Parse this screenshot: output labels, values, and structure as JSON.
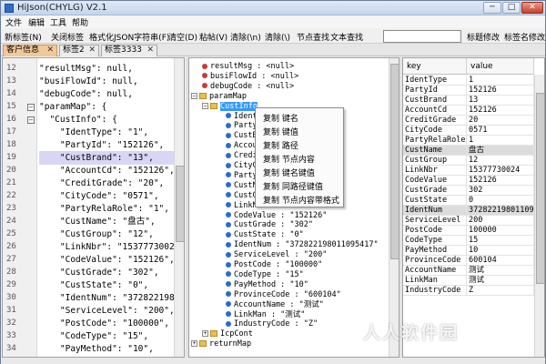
{
  "window": {
    "title": "HiJson(CHYLG) V2.1",
    "min": "─",
    "max": "□",
    "close": "✕"
  },
  "menu": [
    "文件",
    "编辑",
    "工具",
    "帮助"
  ],
  "toolbar": {
    "buttons": [
      "新标签(N)",
      "关闭标签",
      "格式化JSON字符串(F)",
      "清空(D)",
      "粘帖(V)",
      "清除(\\n)",
      "清除(\\)",
      "节点查找",
      "文本查找"
    ],
    "search_value": "",
    "right_buttons": [
      "标题修改",
      "标签名修改"
    ]
  },
  "tabs": [
    {
      "label": "客户信息",
      "close": "✕",
      "active": true
    },
    {
      "label": "标签2",
      "close": "✕",
      "active": false
    },
    {
      "label": "标签3333",
      "close": "✕",
      "active": false
    }
  ],
  "editor": {
    "lines": [
      {
        "n": "12",
        "text": "\"resultMsg\": null,"
      },
      {
        "n": "13",
        "text": "\"busiFlowId\": null,"
      },
      {
        "n": "14",
        "text": "\"debugCode\": null,"
      },
      {
        "n": "15",
        "text": "\"paramMap\": {"
      },
      {
        "n": "16",
        "text": "  \"CustInfo\": {"
      },
      {
        "n": "17",
        "text": "    \"IdentType\": \"1\","
      },
      {
        "n": "18",
        "text": "    \"PartyId\": \"152126\","
      },
      {
        "n": "19",
        "text": "    \"CustBrand\": \"13\","
      },
      {
        "n": "20",
        "text": "    \"AccountCd\": \"152126\","
      },
      {
        "n": "21",
        "text": "    \"CreditGrade\": \"20\","
      },
      {
        "n": "22",
        "text": "    \"CityCode\": \"0571\","
      },
      {
        "n": "23",
        "text": "    \"PartyRelaRole\": \"1\","
      },
      {
        "n": "24",
        "text": "    \"CustName\": \"盘古\","
      },
      {
        "n": "25",
        "text": "    \"CustGroup\": \"12\","
      },
      {
        "n": "26",
        "text": "    \"LinkNbr\": \"1537773002"
      },
      {
        "n": "27",
        "text": "    \"CodeValue\": \"152126\","
      },
      {
        "n": "28",
        "text": "    \"CustGrade\": \"302\","
      },
      {
        "n": "29",
        "text": "    \"CustState\": \"0\","
      },
      {
        "n": "30",
        "text": "    \"IdentNum\": \"372822198"
      },
      {
        "n": "31",
        "text": "    \"ServiceLevel\": \"200\","
      },
      {
        "n": "32",
        "text": "    \"PostCode\": \"100000\","
      },
      {
        "n": "33",
        "text": "    \"CodeType\": \"15\","
      },
      {
        "n": "34",
        "text": "    \"PayMethod\": \"10\","
      }
    ]
  },
  "tree": {
    "nodes": [
      {
        "text": "resultMsg : <null>"
      },
      {
        "text": "busiFlowId : <null>"
      },
      {
        "text": "debugCode : <null>"
      },
      {
        "text": "paramMap"
      },
      {
        "text": "CustInfo"
      },
      {
        "text": "IdentType : \"1\""
      },
      {
        "text": "PartyId : \"152126\""
      },
      {
        "text": "CustBrand : \"13\""
      },
      {
        "text": "AccountCd : \"152126\""
      },
      {
        "text": "CreditGrade : \"20\""
      },
      {
        "text": "CityCode : \"0571\""
      },
      {
        "text": "PartyRelaRole : \"1\""
      },
      {
        "text": "CustName : \"盘古\""
      },
      {
        "text": "CustGroup : \"12\""
      },
      {
        "text": "LinkNbr : \"15377730024\""
      },
      {
        "text": "CodeValue : \"152126\""
      },
      {
        "text": "CustGrade : \"302\""
      },
      {
        "text": "CustState : \"0\""
      },
      {
        "text": "IdentNum : \"372822198011095417\""
      },
      {
        "text": "ServiceLevel : \"200\""
      },
      {
        "text": "PostCode : \"100000\""
      },
      {
        "text": "CodeType : \"15\""
      },
      {
        "text": "PayMethod : \"10\""
      },
      {
        "text": "ProvinceCode : \"600104\""
      },
      {
        "text": "AccountName : \"测试\""
      },
      {
        "text": "LinkMan : \"测试\""
      },
      {
        "text": "IndustryCode : \"Z\""
      },
      {
        "text": "IcpCont"
      },
      {
        "text": "returnMap"
      }
    ]
  },
  "context_menu": [
    "复制 键名",
    "复制 键值",
    "复制 路径",
    "复制 节点内容",
    "复制 键名键值",
    "复制 同路径键值",
    "复制 节点内容带格式"
  ],
  "grid": {
    "headers": [
      "key",
      "value"
    ],
    "rows": [
      [
        "IdentType",
        "1"
      ],
      [
        "PartyId",
        "152126"
      ],
      [
        "CustBrand",
        "13"
      ],
      [
        "AccountCd",
        "152126"
      ],
      [
        "CreditGrade",
        "20"
      ],
      [
        "CityCode",
        "0571"
      ],
      [
        "PartyRelaRole",
        "1"
      ],
      [
        "CustName",
        "盘古"
      ],
      [
        "CustGroup",
        "12"
      ],
      [
        "LinkNbr",
        "15377730024"
      ],
      [
        "CodeValue",
        "152126"
      ],
      [
        "CustGrade",
        "302"
      ],
      [
        "CustState",
        "0"
      ],
      [
        "IdentNum",
        "372822198011095417"
      ],
      [
        "ServiceLevel",
        "200"
      ],
      [
        "PostCode",
        "100000"
      ],
      [
        "CodeType",
        "15"
      ],
      [
        "PayMethod",
        "10"
      ],
      [
        "ProvinceCode",
        "600104"
      ],
      [
        "AccountName",
        "测试"
      ],
      [
        "LinkMan",
        "测试"
      ],
      [
        "IndustryCode",
        "Z"
      ]
    ]
  },
  "watermark": "人人软件园"
}
